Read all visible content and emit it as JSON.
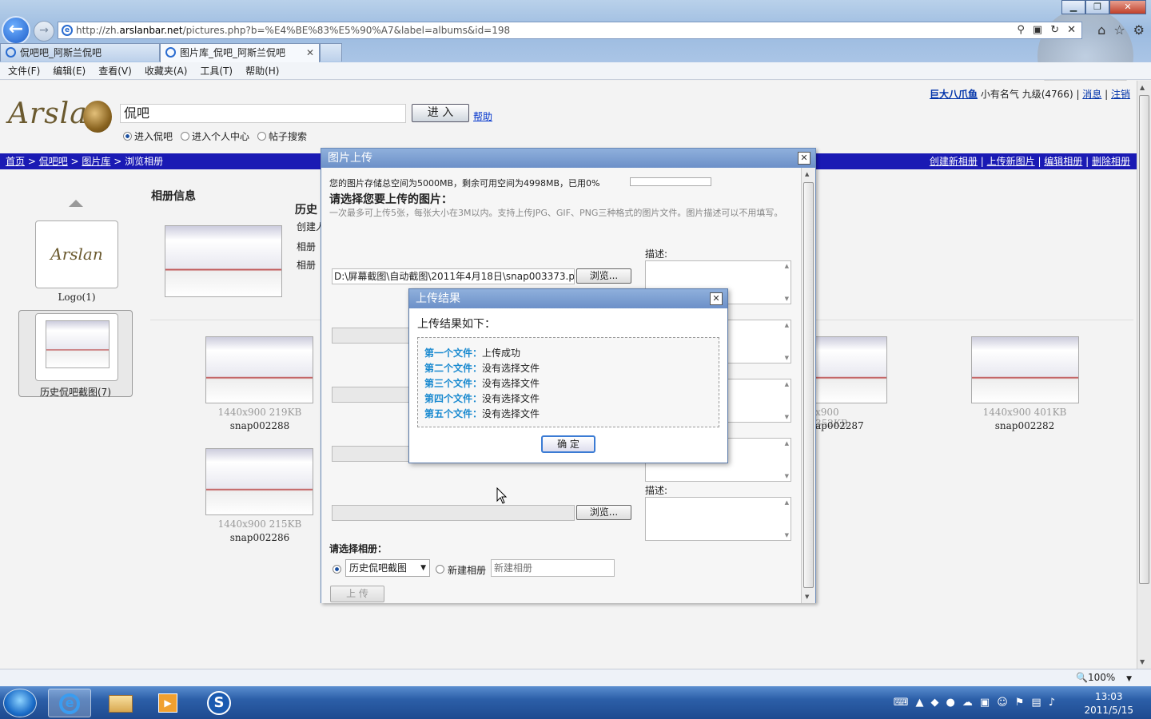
{
  "browser": {
    "url_prefix": "http://zh.",
    "url_host": "arslanbar.net",
    "url_rest": "/pictures.php?b=%E4%BE%83%E5%90%A7&label=albums&id=198",
    "tabs": [
      {
        "label": "侃吧吧_阿斯兰侃吧"
      },
      {
        "label": "图片库_侃吧_阿斯兰侃吧",
        "close": "✕"
      }
    ],
    "menu": [
      "文件(F)",
      "编辑(E)",
      "查看(V)",
      "收藏夹(A)",
      "工具(T)",
      "帮助(H)"
    ]
  },
  "site": {
    "logo_text": "Arslan",
    "search_value": "侃吧",
    "go_button": "进 入",
    "help_link": "帮助",
    "radio_options": [
      "进入侃吧",
      "进入个人中心",
      "帖子搜索"
    ],
    "user": {
      "name": "巨大八爪鱼",
      "title": "小有名气",
      "level": "九级",
      "points": "(4766)",
      "messages": "消息",
      "logout": "注销"
    },
    "breadcrumbs": [
      "首页",
      "侃吧吧",
      "图片库",
      "浏览相册"
    ],
    "actions": [
      "创建新相册",
      "上传新图片",
      "编辑相册",
      "删除相册"
    ]
  },
  "albums": {
    "info_heading": "相册信息",
    "history_title": "历史",
    "history_sub1": "创建人",
    "history_sub2": "相册",
    "history_sub3": "相册",
    "sidebar": [
      {
        "label": "Logo(1)"
      },
      {
        "label": "历史侃吧截图(7)"
      }
    ],
    "pictures": [
      {
        "meta": "1440x900 219KB",
        "name": "snap002288"
      },
      {
        "meta": "1440x900 215KB",
        "name": "snap002286"
      },
      {
        "meta": "x900 352KB",
        "name": "ap002287"
      },
      {
        "meta": "1440x900 401KB",
        "name": "snap002282"
      }
    ]
  },
  "upload_dialog": {
    "title": "图片上传",
    "close": "✕",
    "storage_text": "您的图片存储总空间为5000MB，剩余可用空间为4998MB，已用0%",
    "storage_used_percent": 0,
    "heading": "请选择您要上传的图片：",
    "hint": "一次最多可上传5张，每张大小在3M以内。支持上传JPG、GIF、PNG三种格式的图片文件。图片描述可以不用填写。",
    "desc_label": "描述:",
    "browse_label": "浏览...",
    "file1_value": "D:\\屏幕截图\\自动截图\\2011年4月18日\\snap003373.p",
    "album_label": "请选择相册：",
    "album_selected": "历史侃吧截图",
    "new_album_label": "新建相册",
    "new_album_placeholder": "新建相册",
    "upload_button": "上 传"
  },
  "result_dialog": {
    "title": "上传结果",
    "close": "✕",
    "intro": "上传结果如下：",
    "results": [
      {
        "key": "第一个文件：",
        "value": "上传成功"
      },
      {
        "key": "第二个文件：",
        "value": "没有选择文件"
      },
      {
        "key": "第三个文件：",
        "value": "没有选择文件"
      },
      {
        "key": "第四个文件：",
        "value": "没有选择文件"
      },
      {
        "key": "第五个文件：",
        "value": "没有选择文件"
      }
    ],
    "ok_button": "确 定"
  },
  "status": {
    "zoom": "100%"
  },
  "taskbar": {
    "time": "13:03",
    "date": "2011/5/15"
  },
  "colors": {
    "navbar": "#1a1ab4",
    "dialog_header": "#7a9cd0",
    "result_key": "#1a8ad0"
  }
}
